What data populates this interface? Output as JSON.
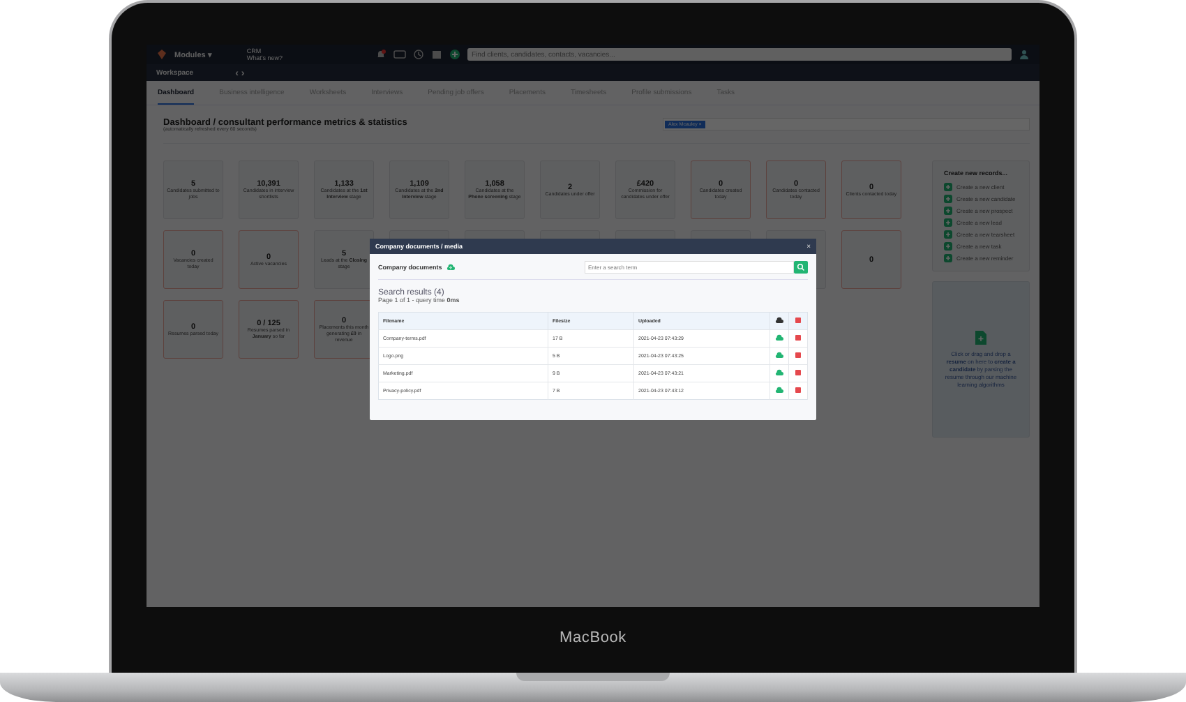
{
  "topbar": {
    "modules": "Modules ▾",
    "crm": "CRM",
    "whats_new": "What's new?",
    "search": {
      "placeholder": "Find clients, candidates, contacts, vacancies..."
    }
  },
  "workspace": {
    "label": "Workspace",
    "arrows": "‹ ›"
  },
  "tabs": [
    {
      "label": "Dashboard",
      "selected": true
    },
    {
      "label": "Business intelligence",
      "selected": false
    },
    {
      "label": "Worksheets",
      "selected": false
    },
    {
      "label": "Interviews",
      "selected": false
    },
    {
      "label": "Pending job offers",
      "selected": false
    },
    {
      "label": "Placements",
      "selected": false
    },
    {
      "label": "Timesheets",
      "selected": false
    },
    {
      "label": "Profile submissions",
      "selected": false
    },
    {
      "label": "Tasks",
      "selected": false
    }
  ],
  "heading": {
    "title": "Dashboard / consultant performance metrics & statistics",
    "subtitle": "(automatically refreshed every 60 seconds)",
    "consultant_tag": "Alex Mcauley ×"
  },
  "stat_rows": [
    [
      {
        "value": "5",
        "label": "Candidates submitted to jobs",
        "alert": false
      },
      {
        "value": "10,391",
        "label": "Candidates in interview shortlists",
        "alert": false
      },
      {
        "value": "1,133",
        "label": "Candidates at the **1st Interview** stage",
        "alert": false
      },
      {
        "value": "1,109",
        "label": "Candidates at the **2nd Interview** stage",
        "alert": false
      },
      {
        "value": "1,058",
        "label": "Candidates at the **Phone screening** stage",
        "alert": false
      },
      {
        "value": "2",
        "label": "Candidates under offer",
        "alert": false
      },
      {
        "value": "£420",
        "label": "Commission for candidates under offer",
        "alert": false
      },
      {
        "value": "0",
        "label": "Candidates created today",
        "alert": true
      },
      {
        "value": "0",
        "label": "Candidates contacted today",
        "alert": true
      },
      {
        "value": "0",
        "label": "Clients contacted today",
        "alert": true
      }
    ],
    [
      {
        "value": "0",
        "label": "Vacancies created today",
        "alert": true
      },
      {
        "value": "0",
        "label": "Active vacancies",
        "alert": true
      },
      {
        "value": "5",
        "label": "Leads at the **Closing** stage",
        "alert": false
      },
      {
        "alert": false
      },
      {
        "alert": false
      },
      {
        "alert": false
      },
      {
        "alert": false
      },
      {
        "alert": false
      },
      {
        "alert": false
      },
      {
        "value": "0",
        "alert": true
      }
    ],
    [
      {
        "value": "0",
        "label": "Resumes parsed today",
        "alert": true
      },
      {
        "value": "0 / 125",
        "label": "Resumes parsed in **January** so far",
        "alert": true
      },
      {
        "value": "0",
        "label": "Placements this month generating **£0** in revenue",
        "alert": true
      }
    ]
  ],
  "create_panel": {
    "title": "Create new records...",
    "items": [
      "Create a new client",
      "Create a new candidate",
      "Create a new prospect",
      "Create a new lead",
      "Create a new tearsheet",
      "Create a new task",
      "Create a new reminder"
    ]
  },
  "dropzone": {
    "text": "Click or drag and drop a **resume** on here to **create a candidate** by parsing the resume through our machine learning algorithms"
  },
  "modal": {
    "title": "Company documents / media",
    "close": "×",
    "section": "Company documents",
    "search": {
      "placeholder": "Enter a search term"
    },
    "results_title": "Search results (4)",
    "results_meta": "Page 1 of 1 - query time **0ms**",
    "table": {
      "columns": [
        "Filename",
        "Filesize",
        "Uploaded"
      ],
      "rows": [
        [
          "Company-terms.pdf",
          "17 B",
          "2021-04-23 07:43:29"
        ],
        [
          "Logo.png",
          "5 B",
          "2021-04-23 07:43:25"
        ],
        [
          "Marketing.pdf",
          "9 B",
          "2021-04-23 07:43:21"
        ],
        [
          "Privacy-policy.pdf",
          "7 B",
          "2021-04-23 07:43:12"
        ]
      ]
    }
  },
  "laptop": {
    "brand": "MacBook"
  }
}
